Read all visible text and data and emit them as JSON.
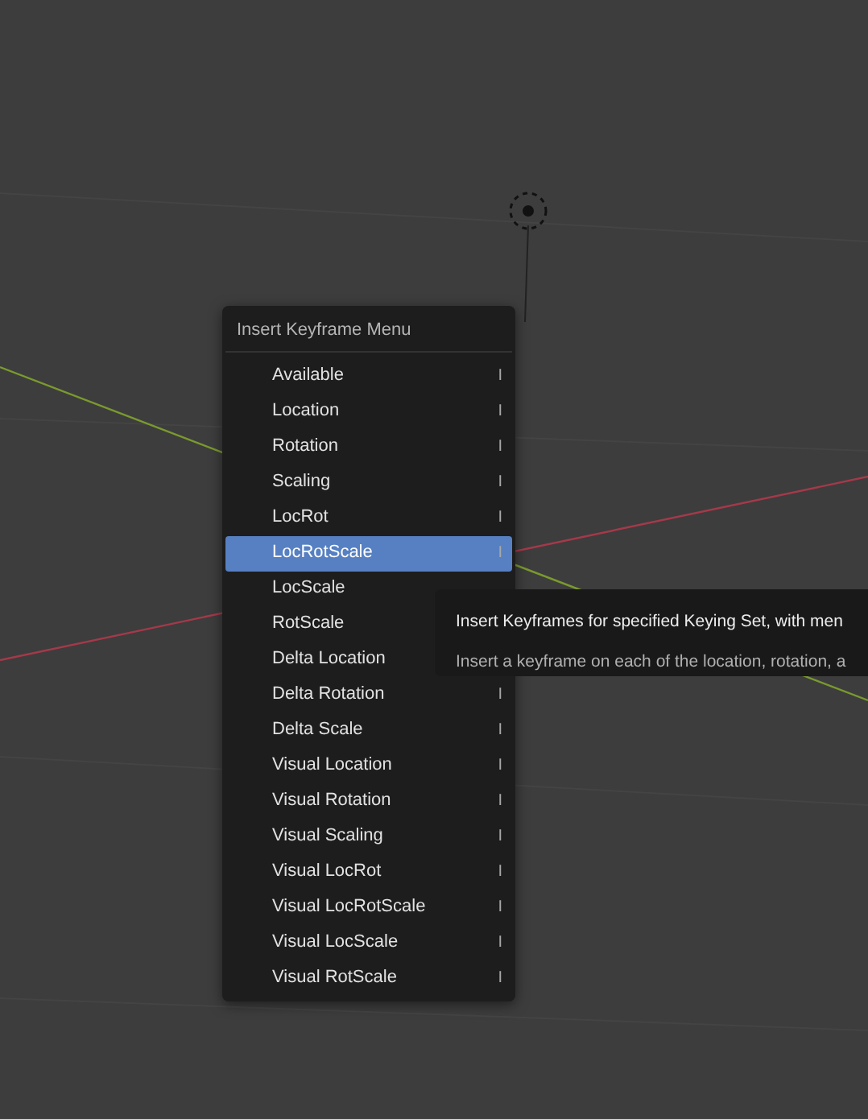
{
  "menu": {
    "title": "Insert Keyframe Menu",
    "items": [
      {
        "label": "Available",
        "shortcut": "I",
        "selected": false
      },
      {
        "label": "Location",
        "shortcut": "I",
        "selected": false
      },
      {
        "label": "Rotation",
        "shortcut": "I",
        "selected": false
      },
      {
        "label": "Scaling",
        "shortcut": "I",
        "selected": false
      },
      {
        "label": "LocRot",
        "shortcut": "I",
        "selected": false
      },
      {
        "label": "LocRotScale",
        "shortcut": "I",
        "selected": true
      },
      {
        "label": "LocScale",
        "selected": false
      },
      {
        "label": "RotScale",
        "selected": false
      },
      {
        "label": "Delta Location",
        "selected": false
      },
      {
        "label": "Delta Rotation",
        "shortcut": "I",
        "selected": false
      },
      {
        "label": "Delta Scale",
        "shortcut": "I",
        "selected": false
      },
      {
        "label": "Visual Location",
        "shortcut": "I",
        "selected": false
      },
      {
        "label": "Visual Rotation",
        "shortcut": "I",
        "selected": false
      },
      {
        "label": "Visual Scaling",
        "shortcut": "I",
        "selected": false
      },
      {
        "label": "Visual LocRot",
        "shortcut": "I",
        "selected": false
      },
      {
        "label": "Visual LocRotScale",
        "shortcut": "I",
        "selected": false
      },
      {
        "label": "Visual LocScale",
        "shortcut": "I",
        "selected": false
      },
      {
        "label": "Visual RotScale",
        "shortcut": "I",
        "selected": false
      }
    ]
  },
  "tooltip": {
    "title": "Insert Keyframes for specified Keying Set, with men",
    "description": "Insert a keyframe on each of the location, rotation, a"
  }
}
